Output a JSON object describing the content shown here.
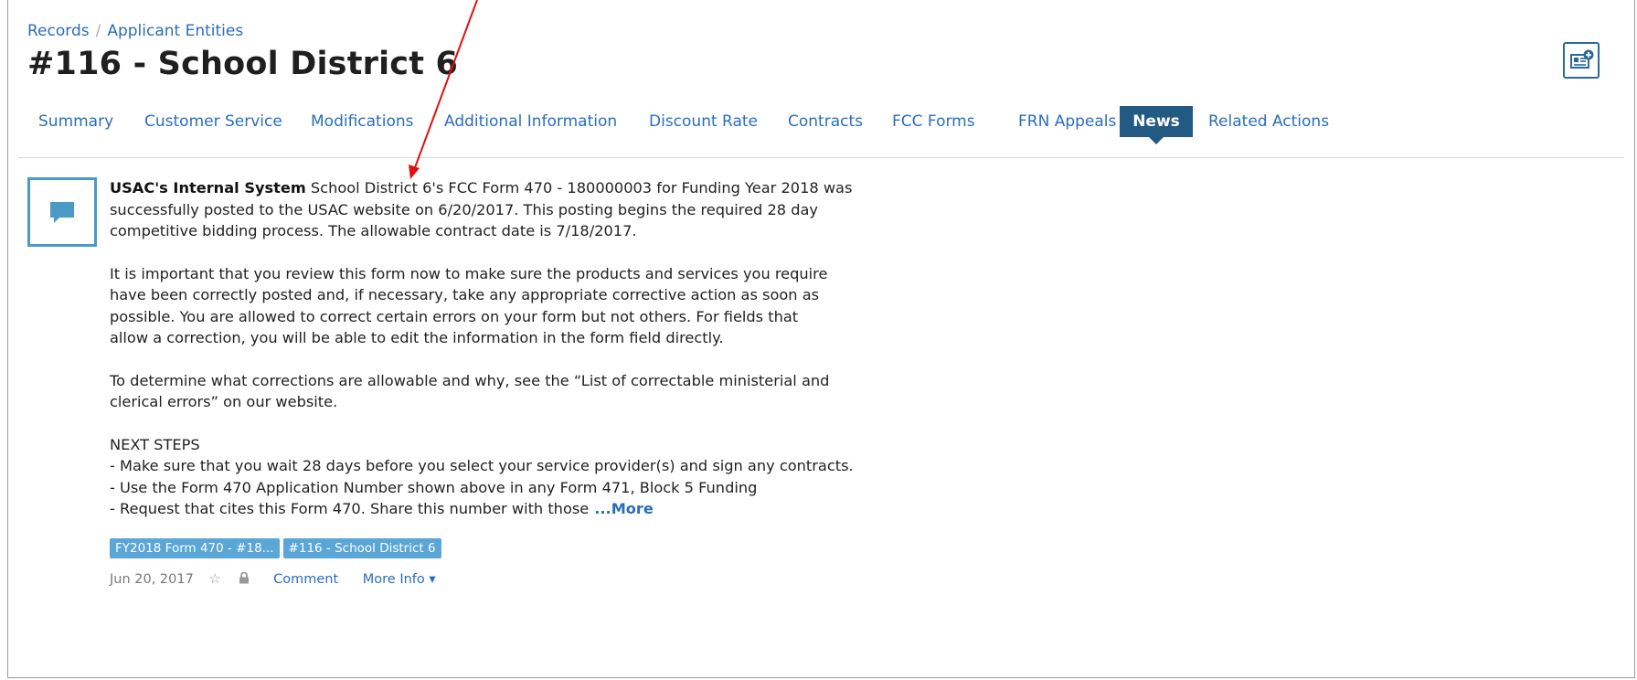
{
  "breadcrumb": {
    "root": "Records",
    "separator": "/",
    "current": "Applicant Entities"
  },
  "page_title": "#116 - School District 6",
  "header_icon": "news-feed-add-icon",
  "tabs": [
    {
      "label": "Summary"
    },
    {
      "label": "Customer Service"
    },
    {
      "label": "Modifications"
    },
    {
      "label": "Additional Information"
    },
    {
      "label": "Discount Rate"
    },
    {
      "label": "Contracts"
    },
    {
      "label": "FCC Forms"
    },
    {
      "label": "FRN Appeals"
    },
    {
      "label": "News",
      "active": true
    },
    {
      "label": "Related Actions"
    }
  ],
  "post": {
    "avatar_icon": "chat-bubble-icon",
    "author": "USAC's Internal System",
    "lines1": [
      "School District 6's FCC Form 470 - 180000003 for Funding Year 2018 was",
      "successfully posted to the USAC website on 6/20/2017. This posting begins the required 28 day",
      "competitive bidding process. The allowable contract date is 7/18/2017."
    ],
    "lines2": [
      "It is important that you review this form now to make sure the products and services you require",
      "have been correctly posted and, if necessary, take any appropriate corrective action as soon as",
      "possible. You are allowed to correct certain errors on your form but not others. For fields that",
      "allow a correction, you will be able to edit the information in the form field directly."
    ],
    "lines3": [
      "To determine what corrections are allowable and why, see the “List of correctable ministerial and",
      "clerical errors” on our website."
    ],
    "next_steps_heading": "NEXT STEPS",
    "next_steps": [
      "- Make sure that you wait 28 days before you select your service provider(s) and sign any contracts.",
      "- Use the Form 470 Application Number shown above in any Form 471, Block 5 Funding",
      "- Request that cites this Form 470. Share this number with those"
    ],
    "more_label": "...More",
    "tags": [
      "FY2018 Form 470 - #18...",
      "#116 - School District 6"
    ],
    "date": "Jun 20, 2017",
    "star_icon": "star-icon",
    "lock_icon": "lock-icon",
    "comment_label": "Comment",
    "more_info_label": "More Info",
    "more_info_caret": "▾"
  },
  "colors": {
    "link": "#2a6ebb",
    "active_tab": "#225a84",
    "tag": "#5aa6d6",
    "annotation_arrow": "#e01010"
  }
}
